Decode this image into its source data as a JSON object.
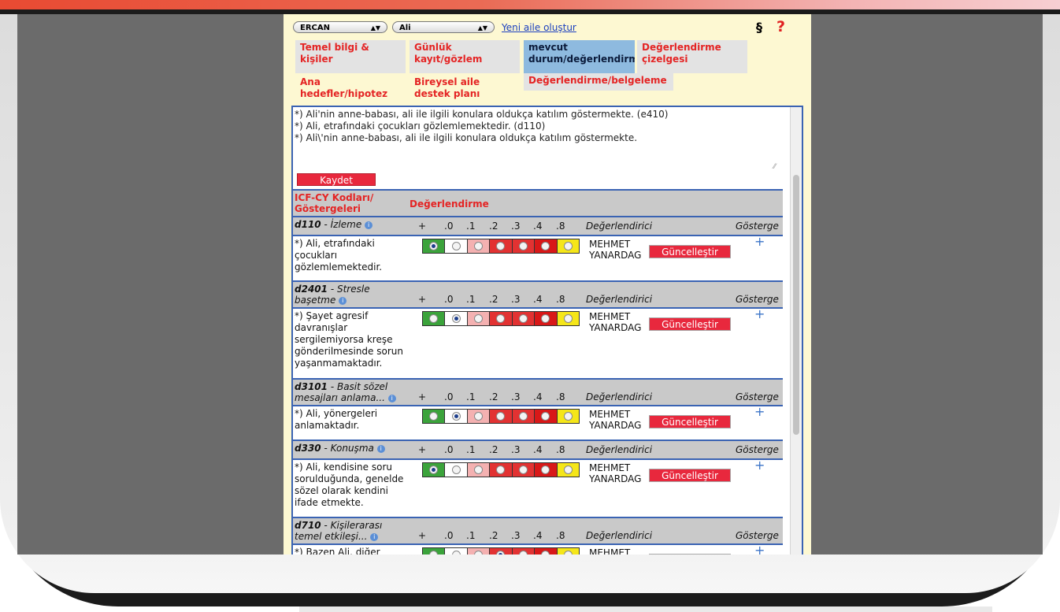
{
  "toolbar": {
    "family_select": "ERCAN",
    "child_select": "Ali",
    "new_family_link": "Yeni aile oluştur",
    "section_symbol": "§",
    "help_symbol": "?"
  },
  "tabs": [
    {
      "label_l1": "Temel bilgi &",
      "label_l2": "kişiler"
    },
    {
      "label_l1": "Günlük",
      "label_l2": "kayıt/gözlem"
    },
    {
      "label_l1": "mevcut",
      "label_l2": "durum/değerlendirme"
    },
    {
      "label_l1": "Değerlendirme",
      "label_l2": "çizelgesi"
    },
    {
      "label_l1": "Ana",
      "label_l2": "hedefler/hipotez"
    },
    {
      "label_l1": "Bireysel aile",
      "label_l2": "destek planı"
    },
    {
      "label_l1": "Değerlendirme/belgeleme",
      "label_l2": ""
    }
  ],
  "notes": [
    "*) Ali'nin anne-babası, ali ile ilgili konulara oldukça katılım göstermekte.   (e410)",
    "*) Ali, etrafındaki çocukları gözlemlemektedir.  (d110)",
    "*) Ali\\'nin anne-babası, ali ile ilgili konulara oldukça katılım göstermekte."
  ],
  "save_label": "Kaydet",
  "table_header": {
    "codes_l1": "ICF-CY Kodları/",
    "codes_l2": "Göstergeleri",
    "evaluation": "Değerlendirme"
  },
  "scale_labels": [
    "+",
    ".0",
    ".1",
    ".2",
    ".3",
    ".4",
    ".8"
  ],
  "col_evaluator": "Değerlendirici",
  "col_indicator": "Gösterge",
  "info_icon": "i",
  "plus_symbol": "+",
  "update_label": "Güncelleştir",
  "evaluator_l1": "MEHMET",
  "evaluator_l2": "YANARDAG",
  "items": [
    {
      "code": "d110",
      "title_l1": "İzleme",
      "title_l2": "",
      "selected": 0,
      "text": [
        "*) Ali, etrafındaki",
        "çocukları",
        "gözlemlemektedir."
      ]
    },
    {
      "code": "d2401",
      "title_l1": "Stresle",
      "title_l2": "başetme",
      "selected": 1,
      "text": [
        "*) Şayet agresif",
        "davranışlar",
        "sergilemiyorsa kreşe",
        "gönderilmesinde sorun",
        "yaşanmamaktadır."
      ]
    },
    {
      "code": "d3101",
      "title_l1": "Basit sözel",
      "title_l2": "mesajları anlama...",
      "selected": 1,
      "text": [
        "*) Ali, yönergeleri",
        "anlamaktadır."
      ]
    },
    {
      "code": "d330",
      "title_l1": "Konuşma",
      "title_l2": "",
      "selected": 0,
      "text": [
        "*) Ali, kendisine soru",
        "sorulduğunda, genelde",
        "sözel olarak kendini",
        "ifade etmekte."
      ]
    },
    {
      "code": "d710",
      "title_l1": "Kişilerarası",
      "title_l2": "temel etkileşi...",
      "selected": 3,
      "text": [
        "*) Bazen Ali, diğer"
      ]
    }
  ]
}
